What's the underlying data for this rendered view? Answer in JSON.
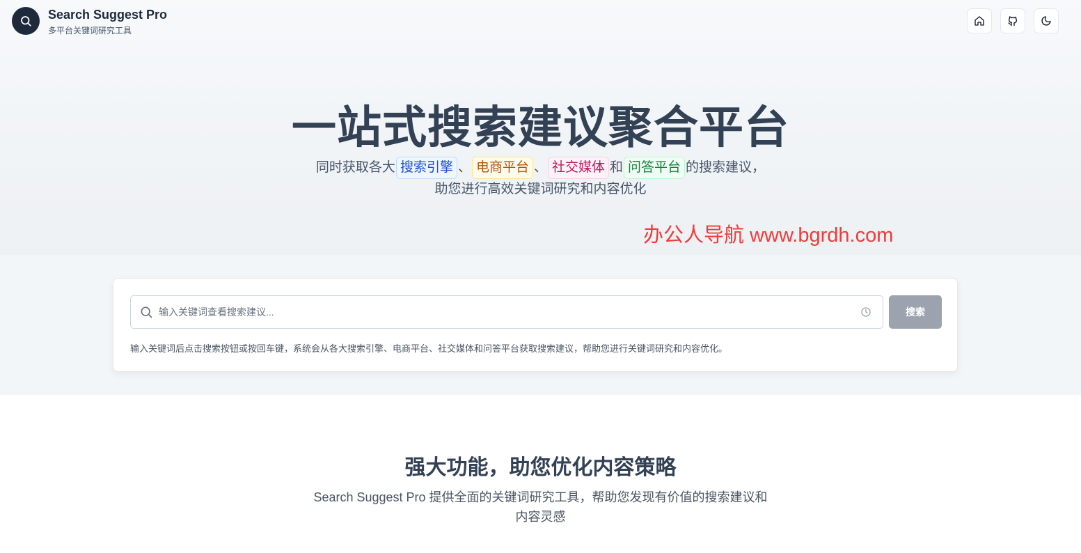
{
  "header": {
    "brand_title": "Search Suggest Pro",
    "brand_subtitle": "多平台关键词研究工具",
    "logo_icon": "search-icon",
    "buttons": [
      {
        "name": "home-button",
        "icon": "home-icon"
      },
      {
        "name": "github-button",
        "icon": "github-icon"
      },
      {
        "name": "theme-toggle-button",
        "icon": "moon-icon"
      }
    ]
  },
  "hero": {
    "title": "一站式搜索建议聚合平台",
    "desc_prefix": "同时获取各大",
    "tags": [
      {
        "label": "搜索引擎",
        "color": "#1d4ed8"
      },
      {
        "label": "电商平台",
        "color": "#b45309"
      },
      {
        "label": "社交媒体",
        "color": "#be185d"
      },
      {
        "label": "问答平台",
        "color": "#15803d"
      }
    ],
    "sep1": "、",
    "sep2": "、",
    "sep3": "和",
    "desc_suffix": "的搜索建议，",
    "desc_line2": "助您进行高效关键词研究和内容优化"
  },
  "watermark": "办公人导航 www.bgrdh.com",
  "search": {
    "placeholder": "输入关键词查看搜索建议...",
    "value": "",
    "button_label": "搜索",
    "hint": "输入关键词后点击搜索按钮或按回车键，系统会从各大搜索引擎、电商平台、社交媒体和问答平台获取搜索建议，帮助您进行关键词研究和内容优化。"
  },
  "features": {
    "title": "强大功能，助您优化内容策略",
    "desc_line1": "Search Suggest Pro 提供全面的关键词研究工具，帮助您发现有价值的搜索建议和",
    "desc_line2": "内容灵感"
  },
  "colors": {
    "brand_dark": "#1e293b",
    "button_disabled": "#9ca3af",
    "watermark_red": "#ef3b3b"
  }
}
